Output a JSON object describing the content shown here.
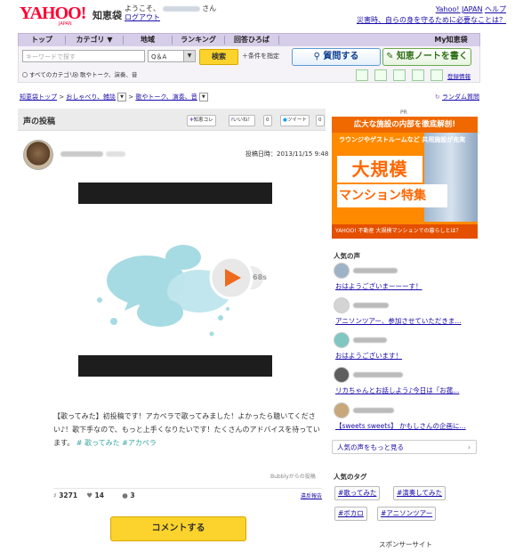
{
  "header": {
    "logo": "YAHOO!",
    "logo_sub": "JAPAN",
    "service": "知恵袋",
    "welcome": "ようこそ、",
    "san": "さん",
    "logout": "ログアウト",
    "links": [
      "Yahoo! JAPAN",
      "ヘルプ"
    ],
    "disaster": "災害時、自らの身を守るために必要なことは？"
  },
  "nav": [
    "トップ",
    "カテゴリ ▼",
    "地域",
    "ランキング",
    "回答ひろば",
    "My知恵袋"
  ],
  "search": {
    "placeholder": "キーワードで探す",
    "category": "Q＆A",
    "button": "検索",
    "conditions": "＋条件を指定",
    "radio_all": "すべてのカテゴリ",
    "radio_song": "歌やトーク、演奏、音",
    "ask": "質問する",
    "note": "知恵ノートを書く",
    "register": "登録情報"
  },
  "breadcrumb": [
    "知恵袋トップ",
    "おしゃべり、雑談",
    "歌やトーク、演奏、音"
  ],
  "random": "ランダム質問",
  "post": {
    "section": "声の投稿",
    "share": [
      "知恵コレ",
      "いいね！",
      "0",
      "ツイート",
      "0"
    ],
    "date": "投稿日時：2013/11/15 9:48",
    "duration": "68s",
    "body": "【歌ってみた】初投稿です！アカペラで歌ってみました！よかったら聴いてください♪！歌下手なので、もっと上手くなりたいです！たくさんのアドバイスを待っています。",
    "tags": "# 歌ってみた #アカペラ",
    "source": "Bubblyからの投稿",
    "stats": {
      "listens": "3271",
      "likes": "14",
      "comments": "3"
    },
    "report": "違反報告",
    "comment_btn": "コメントする"
  },
  "ad": {
    "pr": "PR",
    "band": "広大な施設の内部を徹底解剖!",
    "sub": "ラウンジやゲストルームなど 共用施設が充実",
    "big1": "大規模",
    "big2": "マンション特集",
    "foot": "YAHOO! 不動産  大規模マンションでの暮らしとは？"
  },
  "popular_voices": {
    "title": "人気の声",
    "items": [
      {
        "msg": "おはようございまーーーす！",
        "color": "#9fb3c7"
      },
      {
        "msg": "アニソンツアー、参加させていただきま...",
        "color": "#d4d4d4"
      },
      {
        "msg": "おはようございます！",
        "color": "#7fc7c0"
      },
      {
        "msg": "リカちゃんとお話しよう♪今日は「お菰...",
        "color": "#5e5e5e"
      },
      {
        "msg": "【sweets sweets】 かもしさんの企画に...",
        "color": "#c8a87a"
      }
    ],
    "more": "人気の声をもっと見る"
  },
  "popular_tags": {
    "title": "人気のタグ",
    "tags": [
      "#歌ってみた",
      "#演奏してみた",
      "#ボカロ",
      "#アニソンツアー"
    ]
  },
  "sponsor": "スポンサーサイト"
}
